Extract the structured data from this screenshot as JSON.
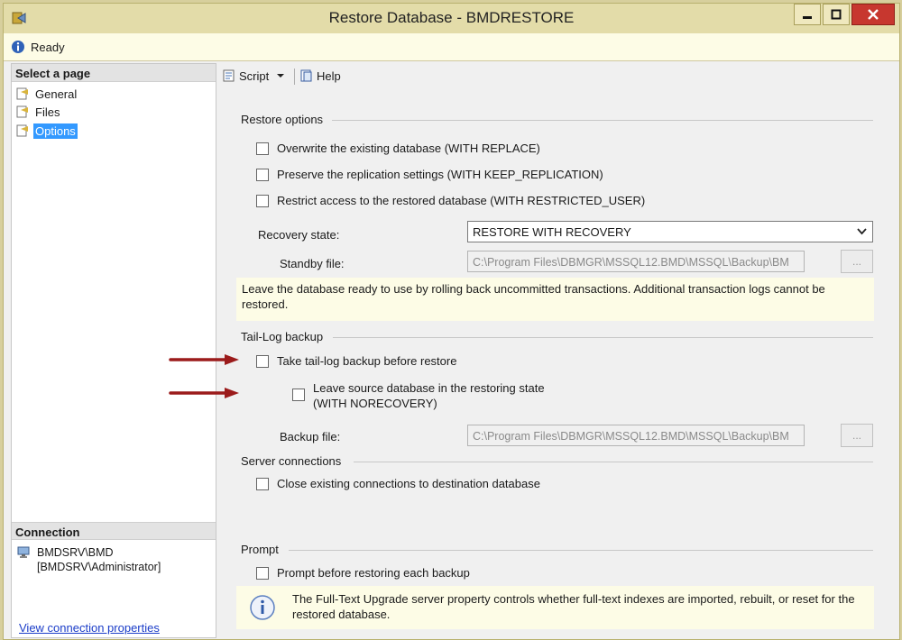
{
  "window": {
    "title": "Restore Database - BMDRESTORE"
  },
  "status": {
    "text": "Ready"
  },
  "left_pane": {
    "select_page_header": "Select a page",
    "pages": [
      {
        "label": "General",
        "selected": false
      },
      {
        "label": "Files",
        "selected": false
      },
      {
        "label": "Options",
        "selected": true
      }
    ],
    "connection_header": "Connection",
    "connection_lines": [
      "BMDSRV\\BMD",
      "[BMDSRV\\Administrator]"
    ],
    "view_connection_link": "View connection properties"
  },
  "toolbar": {
    "script_label": "Script",
    "help_label": "Help"
  },
  "restore_options": {
    "title": "Restore options",
    "checkboxes": [
      {
        "label": "Overwrite the existing database (WITH REPLACE)",
        "checked": false
      },
      {
        "label": "Preserve the replication settings (WITH KEEP_REPLICATION)",
        "checked": false
      },
      {
        "label": "Restrict access to the restored database (WITH RESTRICTED_USER)",
        "checked": false
      }
    ],
    "recovery_state_label": "Recovery state:",
    "recovery_state_value": "RESTORE WITH RECOVERY",
    "standby_file_label": "Standby file:",
    "standby_file_value": "C:\\Program Files\\DBMGR\\MSSQL12.BMD\\MSSQL\\Backup\\BM",
    "browse_label": "...",
    "note": "Leave the database ready to use by rolling back uncommitted transactions. Additional transaction logs cannot be restored."
  },
  "tail_log": {
    "title": "Tail-Log backup",
    "take_backup_label": "Take tail-log backup before restore",
    "take_backup_checked": false,
    "leave_source_line1": "Leave source database in the restoring state",
    "leave_source_line2": "(WITH NORECOVERY)",
    "leave_source_checked": false,
    "backup_file_label": "Backup file:",
    "backup_file_value": "C:\\Program Files\\DBMGR\\MSSQL12.BMD\\MSSQL\\Backup\\BM",
    "browse_label": "..."
  },
  "server_connections": {
    "title": "Server connections",
    "close_label": "Close existing connections to destination database",
    "close_checked": false
  },
  "prompt": {
    "title": "Prompt",
    "prompt_label": "Prompt before restoring each backup",
    "prompt_checked": false,
    "info_text": "The Full-Text Upgrade server property controls whether full-text indexes are imported, rebuilt, or reset for the restored database."
  },
  "colors": {
    "annotation_arrow": "#9b1b1b",
    "selection": "#3399ff",
    "titlebar": "#e3dca9",
    "note_background": "#fdfce6"
  },
  "icons": [
    "app-icon",
    "info-icon",
    "page-icon",
    "script-icon",
    "help-icon",
    "connection-icon",
    "minimize-icon",
    "maximize-icon",
    "close-icon",
    "chevron-down-icon"
  ]
}
